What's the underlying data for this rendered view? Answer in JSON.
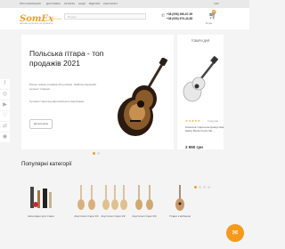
{
  "topbar": {
    "links": [
      "ПРО КОМПАНІЮ",
      "ДОСТАВКА",
      "ОПЛАТА",
      "АКЦІЇ",
      "ВІДГУКИ",
      "КОНТАКТИ"
    ],
    "lang": "УКР"
  },
  "header": {
    "logo": "SomEx",
    "logo_sub": ".com.ua",
    "tagline": "магазин музичних інструментів",
    "search_placeholder": "Пошук...",
    "phone1": "+38 (098) 396-67-99",
    "phone2": "+38 (050) 579-43-85",
    "cart_count": "0",
    "cart_price": "0 грн"
  },
  "slider": {
    "title": "Польська гітара - топ продажів 2021",
    "text": "Різних повних розмірів 4/4 розміри. Найпопулярніший сегмент гітарних",
    "text2": "Сучасні гітари від європейського виробника",
    "button": "Детальніше",
    "active_slide": 1,
    "slide_count": 2
  },
  "side": {
    "title": "ТОВАРИ ДНЯ",
    "rating": "★★★★★",
    "reviews": "0 відгуків",
    "product_name": "Класична гітара-електроакустика Harley Benton Fenix CE...",
    "price": "2 990 грн"
  },
  "social": [
    "facebook-icon",
    "instagram-icon",
    "youtube-icon",
    "heart-icon",
    "compare-icon",
    "eye-icon"
  ],
  "categories_title": "Популярні категорії",
  "categories": [
    {
      "label": "Аксесуари для гітари"
    },
    {
      "label": "Акустичні гітари 1/4"
    },
    {
      "label": "Акустичні гітари 1/2"
    },
    {
      "label": "Акустичні гітари 3/4"
    },
    {
      "label": "Гітари з вибором"
    }
  ],
  "colors": {
    "accent": "#f0a020",
    "chat": "#f59a1b"
  }
}
